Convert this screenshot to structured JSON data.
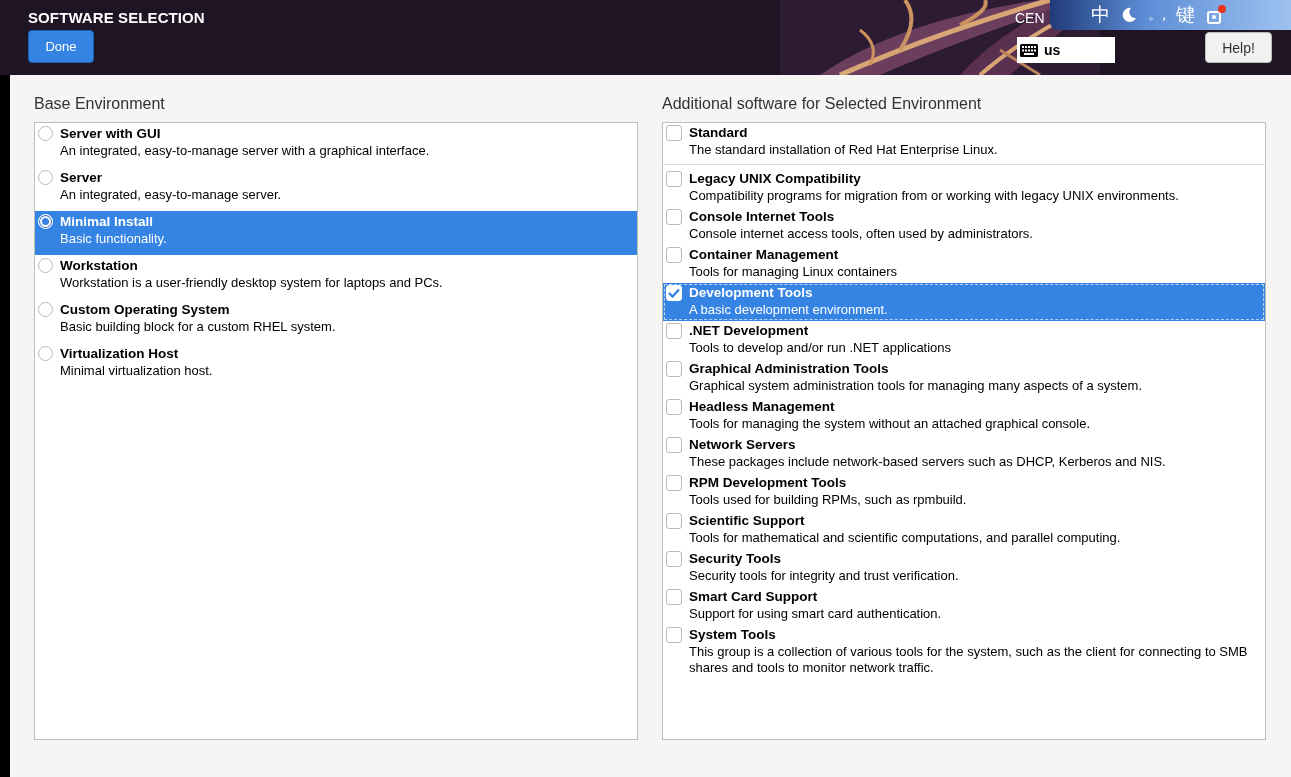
{
  "header": {
    "title": "SOFTWARE SELECTION",
    "done_button": "Done",
    "product_label": "CEN",
    "keyboard_layout": "us",
    "help_button": "Help!",
    "ime_toolbar": {
      "mode": "中",
      "punctuation": "。,",
      "soft_keyboard": "键"
    }
  },
  "panels": [
    {
      "kind": "radio",
      "heading": "Base Environment",
      "items": [
        {
          "name": "Server with GUI",
          "description": "An integrated, easy-to-manage server with a graphical interface.",
          "selected": false
        },
        {
          "name": "Server",
          "description": "An integrated, easy-to-manage server.",
          "selected": false
        },
        {
          "name": "Minimal Install",
          "description": "Basic functionality.",
          "selected": true
        },
        {
          "name": "Workstation",
          "description": "Workstation is a user-friendly desktop system for laptops and PCs.",
          "selected": false
        },
        {
          "name": "Custom Operating System",
          "description": "Basic building block for a custom RHEL system.",
          "selected": false
        },
        {
          "name": "Virtualization Host",
          "description": "Minimal virtualization host.",
          "selected": false
        }
      ]
    },
    {
      "kind": "checkbox",
      "heading": "Additional software for Selected Environment",
      "items": [
        {
          "name": "Standard",
          "description": "The standard installation of Red Hat Enterprise Linux.",
          "checked": false,
          "selected": false
        },
        {
          "name": "Legacy UNIX Compatibility",
          "description": "Compatibility programs for migration from or working with legacy UNIX environments.",
          "checked": false,
          "selected": false
        },
        {
          "name": "Console Internet Tools",
          "description": "Console internet access tools, often used by administrators.",
          "checked": false,
          "selected": false
        },
        {
          "name": "Container Management",
          "description": "Tools for managing Linux containers",
          "checked": false,
          "selected": false
        },
        {
          "name": "Development Tools",
          "description": "A basic development environment.",
          "checked": true,
          "selected": true
        },
        {
          "name": ".NET Development",
          "description": "Tools to develop and/or run .NET applications",
          "checked": false,
          "selected": false
        },
        {
          "name": "Graphical Administration Tools",
          "description": "Graphical system administration tools for managing many aspects of a system.",
          "checked": false,
          "selected": false
        },
        {
          "name": "Headless Management",
          "description": "Tools for managing the system without an attached graphical console.",
          "checked": false,
          "selected": false
        },
        {
          "name": "Network Servers",
          "description": "These packages include network-based servers such as DHCP, Kerberos and NIS.",
          "checked": false,
          "selected": false
        },
        {
          "name": "RPM Development Tools",
          "description": "Tools used for building RPMs, such as rpmbuild.",
          "checked": false,
          "selected": false
        },
        {
          "name": "Scientific Support",
          "description": "Tools for mathematical and scientific computations, and parallel computing.",
          "checked": false,
          "selected": false
        },
        {
          "name": "Security Tools",
          "description": "Security tools for integrity and trust verification.",
          "checked": false,
          "selected": false
        },
        {
          "name": "Smart Card Support",
          "description": "Support for using smart card authentication.",
          "checked": false,
          "selected": false
        },
        {
          "name": "System Tools",
          "description": "This group is a collection of various tools for the system, such as the client for connecting to SMB shares and tools to monitor network traffic.",
          "checked": false,
          "selected": false
        }
      ]
    }
  ]
}
